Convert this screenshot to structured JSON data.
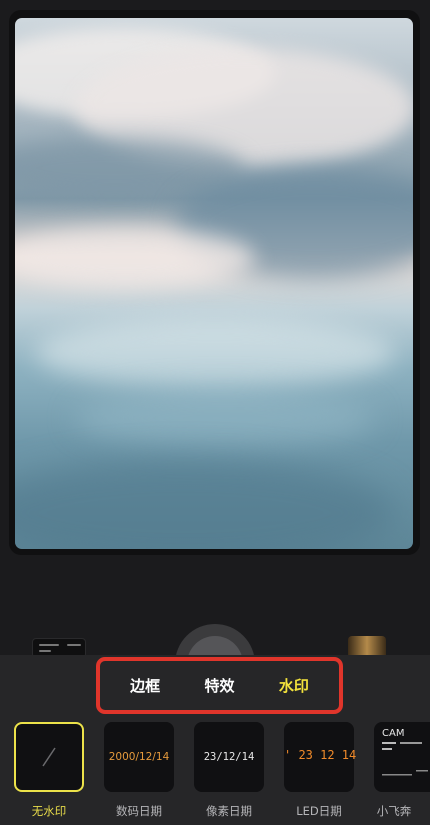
{
  "tabs": [
    {
      "label": "边框",
      "active": false
    },
    {
      "label": "特效",
      "active": false
    },
    {
      "label": "水印",
      "active": true
    }
  ],
  "watermarks": [
    {
      "label": "无水印",
      "preview": "",
      "selected": true
    },
    {
      "label": "数码日期",
      "preview": "2000/12/14",
      "selected": false,
      "color": "#e59a3c"
    },
    {
      "label": "像素日期",
      "preview": "23/12/14",
      "selected": false,
      "color": "#e8e8e8"
    },
    {
      "label": "LED日期",
      "preview": "' 23 12 14",
      "selected": false,
      "color": "#f08a2a"
    },
    {
      "label": "小飞奔",
      "preview": "CAM",
      "selected": false,
      "color": "#e8e8e8"
    }
  ],
  "colors": {
    "accent": "#f2e23c",
    "highlight_border": "#e0352b",
    "panel": "#262628"
  }
}
